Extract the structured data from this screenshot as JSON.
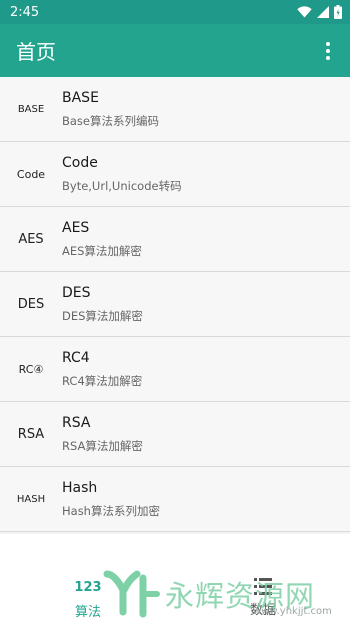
{
  "status_bar": {
    "time": "2:45",
    "icons": [
      "wifi-icon",
      "signal-icon",
      "battery-icon"
    ]
  },
  "app_bar": {
    "title": "首页",
    "menu_icon": "more-vert-icon"
  },
  "items": [
    {
      "icon_text": "BASE",
      "title": "BASE",
      "subtitle": "Base算法系列编码"
    },
    {
      "icon_text": "Code",
      "title": "Code",
      "subtitle": "Byte,Url,Unicode转码"
    },
    {
      "icon_text": "AES",
      "title": "AES",
      "subtitle": "AES算法加解密"
    },
    {
      "icon_text": "DES",
      "title": "DES",
      "subtitle": "DES算法加解密"
    },
    {
      "icon_text": "RC④",
      "title": "RC4",
      "subtitle": "RC4算法加解密"
    },
    {
      "icon_text": "RSA",
      "title": "RSA",
      "subtitle": "RSA算法加解密"
    },
    {
      "icon_text": "HASH",
      "title": "Hash",
      "subtitle": "Hash算法系列加密"
    }
  ],
  "bottom_nav": {
    "tab1": {
      "icon_text": "123",
      "label": "算法",
      "active": true
    },
    "tab2": {
      "icon": "grid-icon",
      "label": "数据",
      "active": false
    }
  },
  "watermark": {
    "text": "永辉资源网",
    "url": "www.yhkjjt.com"
  },
  "colors": {
    "primary": "#22a48f",
    "status_bar": "#1f9a8a"
  }
}
